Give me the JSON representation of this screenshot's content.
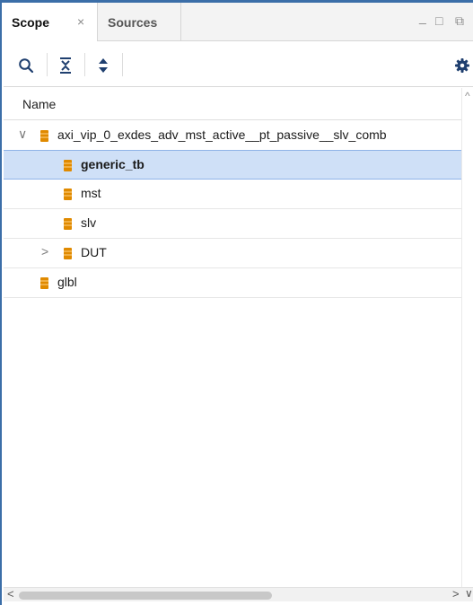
{
  "tabs": [
    {
      "label": "Scope",
      "close": "×",
      "active": true
    },
    {
      "label": "Sources",
      "active": false
    }
  ],
  "window_controls": {
    "minimize": "_",
    "maximize": "□",
    "float": "⧉"
  },
  "toolbar": {
    "icons": [
      "search-icon",
      "collapse-all-icon",
      "expand-all-icon",
      "gear-icon"
    ]
  },
  "columns": {
    "name": "Name"
  },
  "tree": [
    {
      "label": "axi_vip_0_exdes_adv_mst_active__pt_passive__slv_comb",
      "expander": "∨",
      "bold": false,
      "selected": false
    },
    {
      "label": "generic_tb",
      "bold": true,
      "selected": true
    },
    {
      "label": "mst",
      "bold": false,
      "selected": false
    },
    {
      "label": "slv",
      "bold": false,
      "selected": false
    },
    {
      "label": "DUT",
      "expander": ">",
      "bold": false,
      "selected": false
    },
    {
      "label": "glbl",
      "bold": false,
      "selected": false
    }
  ],
  "scrollbar": {
    "left": "<",
    "right": ">",
    "up": "^",
    "down": "∨"
  },
  "colors": {
    "accent": "#3b6ea8",
    "selection": "#cfe0f7",
    "chip": "#e08a00"
  }
}
